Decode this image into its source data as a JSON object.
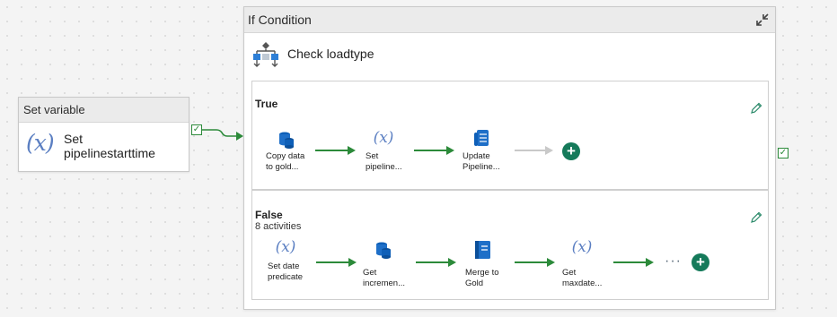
{
  "set_variable": {
    "header": "Set variable",
    "icon_glyph": "(x)",
    "label_line1": "Set",
    "label_line2": "pipelinestarttime",
    "check": "✓"
  },
  "if_condition": {
    "header": "If Condition",
    "title": "Check loadtype",
    "collapse_icon": "collapse-arrows-icon",
    "outer_check": "✓"
  },
  "true_branch": {
    "title": "True",
    "activities": [
      {
        "icon": "copy-database-icon",
        "line1": "Copy data",
        "line2": "to gold..."
      },
      {
        "icon": "(x)",
        "line1": "Set",
        "line2": "pipeline..."
      },
      {
        "icon": "stored-procedure-icon",
        "line1": "Update",
        "line2": "Pipeline..."
      }
    ],
    "add_glyph": "+"
  },
  "false_branch": {
    "title": "False",
    "subtitle": "8 activities",
    "activities": [
      {
        "icon": "(x)",
        "line1": "Set date",
        "line2": "predicate"
      },
      {
        "icon": "database-icon",
        "line1": "Get",
        "line2": "incremen..."
      },
      {
        "icon": "notebook-icon",
        "line1": "Merge to",
        "line2": "Gold"
      },
      {
        "icon": "(x)",
        "line1": "Get",
        "line2": "maxdate..."
      }
    ],
    "more_glyph": "···",
    "add_glyph": "+"
  },
  "colors": {
    "success_green": "#2c8a3a",
    "accent_blue": "#1e6fc8",
    "add_button": "#157a5a"
  }
}
